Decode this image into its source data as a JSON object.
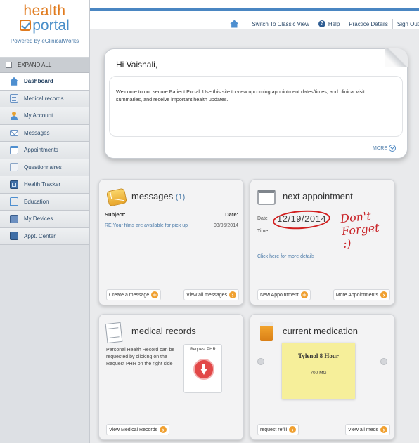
{
  "logo": {
    "line1": "health",
    "line2": "portal",
    "powered": "Powered by eClinicalWorks"
  },
  "sidebar": {
    "expand_label": "EXPAND ALL",
    "items": [
      {
        "label": "Dashboard",
        "icon": "home-icon"
      },
      {
        "label": "Medical records",
        "icon": "document-icon"
      },
      {
        "label": "My Account",
        "icon": "person-icon"
      },
      {
        "label": "Messages",
        "icon": "mail-icon"
      },
      {
        "label": "Appointments",
        "icon": "calendar-icon"
      },
      {
        "label": "Questionnaires",
        "icon": "questionnaire-icon"
      },
      {
        "label": "Health Tracker",
        "icon": "tracker-icon"
      },
      {
        "label": "Education",
        "icon": "education-icon"
      },
      {
        "label": "My Devices",
        "icon": "device-icon"
      },
      {
        "label": "Appt. Center",
        "icon": "appointment-center-icon"
      }
    ]
  },
  "topbar": {
    "classic": "Switch To Classic View",
    "help": "Help",
    "practice": "Practice Details",
    "signout": "Sign Out"
  },
  "welcome": {
    "greeting": "Hi Vaishali,",
    "message": "Welcome to our secure Patient Portal. Use this site to view upcoming appointment dates/times, and clinical visit summaries, and receive important health updates.",
    "more": "MORE"
  },
  "messages": {
    "title": "messages",
    "count": "(1)",
    "col_subject": "Subject:",
    "col_date": "Date:",
    "row_subject": "RE:Your films are available for pick up",
    "row_date": "03/05/2014",
    "create": "Create a message",
    "view_all": "View all messages"
  },
  "appointment": {
    "title": "next appointment",
    "date_label": "Date",
    "time_label": "Time",
    "date": "12/19/2014",
    "handwritten": "Don't Forget :)",
    "details_link": "Click here for more details",
    "new": "New Appointment",
    "more": "More Appointments"
  },
  "records": {
    "title": "medical records",
    "text": "Personal Health Record can be requested by clicking on the Request PHR on the right side",
    "phr_label": "Request PHR",
    "view": "View Medical Records"
  },
  "medication": {
    "title": "current medication",
    "drug": "Tylenol 8 Hour",
    "dose": "700 MG",
    "refill": "request refill",
    "view_all": "View all meds"
  },
  "colors": {
    "accent": "#4a86c2",
    "brand_orange": "#e07b1f",
    "handwriting_red": "#c9252a",
    "plus_orange": "#f0a030"
  }
}
